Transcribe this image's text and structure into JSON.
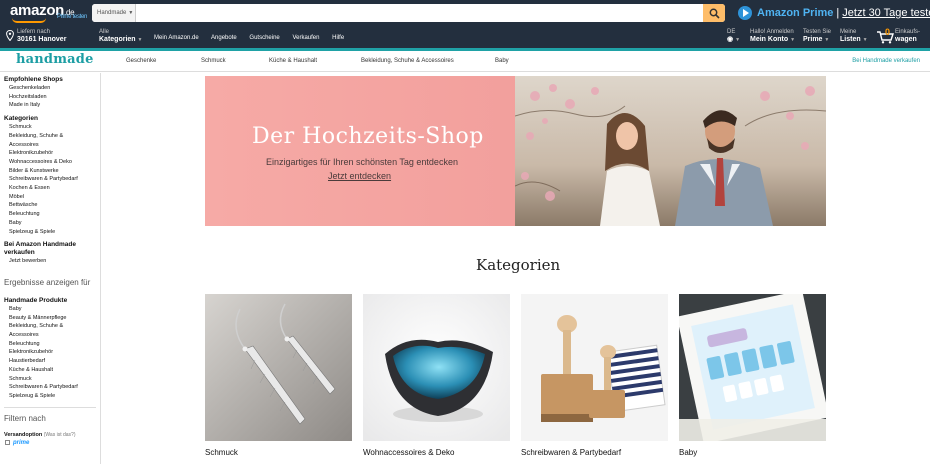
{
  "header": {
    "logo_text": "amazon",
    "logo_tld": ".de",
    "logo_prime": "Prime testen",
    "search_dept": "Handmade",
    "search_value": "",
    "search_placeholder": "",
    "prime_promo": {
      "brand": "Amazon Prime",
      "separator": "|",
      "offer": "Jetzt 30 Tage testen"
    }
  },
  "nav": {
    "deliver_line1": "Liefern nach",
    "deliver_line2": "30161 Hanover",
    "all_line1": "Alle",
    "all_line2": "Kategorien",
    "links": [
      "Mein Amazon.de",
      "Angebote",
      "Gutscheine",
      "Verkaufen",
      "Hilfe"
    ],
    "lang_line1": "DE",
    "account_line1": "Hallo! Anmelden",
    "account_line2": "Mein Konto",
    "prime_line1": "Testen Sie",
    "prime_line2": "Prime",
    "lists_line1": "Meine",
    "lists_line2": "Listen",
    "cart_count": "0",
    "cart_line1": "Einkaufs-",
    "cart_line2": "wagen"
  },
  "handmade_nav": {
    "logo": "handmade",
    "items": [
      "Geschenke",
      "Schmuck",
      "Küche & Haushalt",
      "Bekleidung, Schuhe & Accessoires",
      "Baby"
    ],
    "sell_link": "Bei Handmade verkaufen"
  },
  "sidebar": {
    "shops_heading": "Empfohlene Shops",
    "shops": [
      "Geschenkeladen",
      "Hochzeitsladen",
      "Made in Italy"
    ],
    "categories_heading": "Kategorien",
    "categories": [
      "Schmuck",
      "Bekleidung, Schuhe &",
      "Accessoires",
      "Elektronikzubehör",
      "Wohnaccessoires & Deko",
      "Bilder & Kunstwerke",
      "Schreibwaren & Partybedarf",
      "Kochen & Essen",
      "Möbel",
      "Bettwäsche",
      "Beleuchtung",
      "Baby",
      "Spielzeug & Spiele"
    ],
    "seller_heading_1": "Bei Amazon Handmade",
    "seller_heading_2": "verkaufen",
    "seller_link": "Jetzt bewerben",
    "results_heading": "Ergebnisse anzeigen für",
    "products_heading": "Handmade Produkte",
    "products": [
      "Baby",
      "Beauty & Männerpflege",
      "Bekleidung, Schuhe &",
      "Accessoires",
      "Beleuchtung",
      "Elektronikzubehör",
      "Haustierbedarf",
      "Küche & Haushalt",
      "Schmuck",
      "Schreibwaren & Partybedarf",
      "Spielzeug & Spiele"
    ],
    "filter_heading": "Filtern nach",
    "shipping_heading": "Versandoption",
    "shipping_sub": "(Was ist das?)",
    "prime_label": "prime"
  },
  "hero": {
    "title": "Der Hochzeits-Shop",
    "subtitle": "Einzigartiges für Ihren schönsten Tag entdecken",
    "cta": "Jetzt entdecken"
  },
  "categories": {
    "heading": "Kategorien",
    "tiles": [
      {
        "label": "Schmuck"
      },
      {
        "label": "Wohnaccessoires & Deko"
      },
      {
        "label": "Schreibwaren & Partybedarf"
      },
      {
        "label": "Baby"
      }
    ]
  },
  "colors": {
    "amazon_dark": "#232f3e",
    "accent_orange": "#ff9900",
    "handmade_teal": "#1d9ea4",
    "hero_pink": "#f6aaa6"
  }
}
